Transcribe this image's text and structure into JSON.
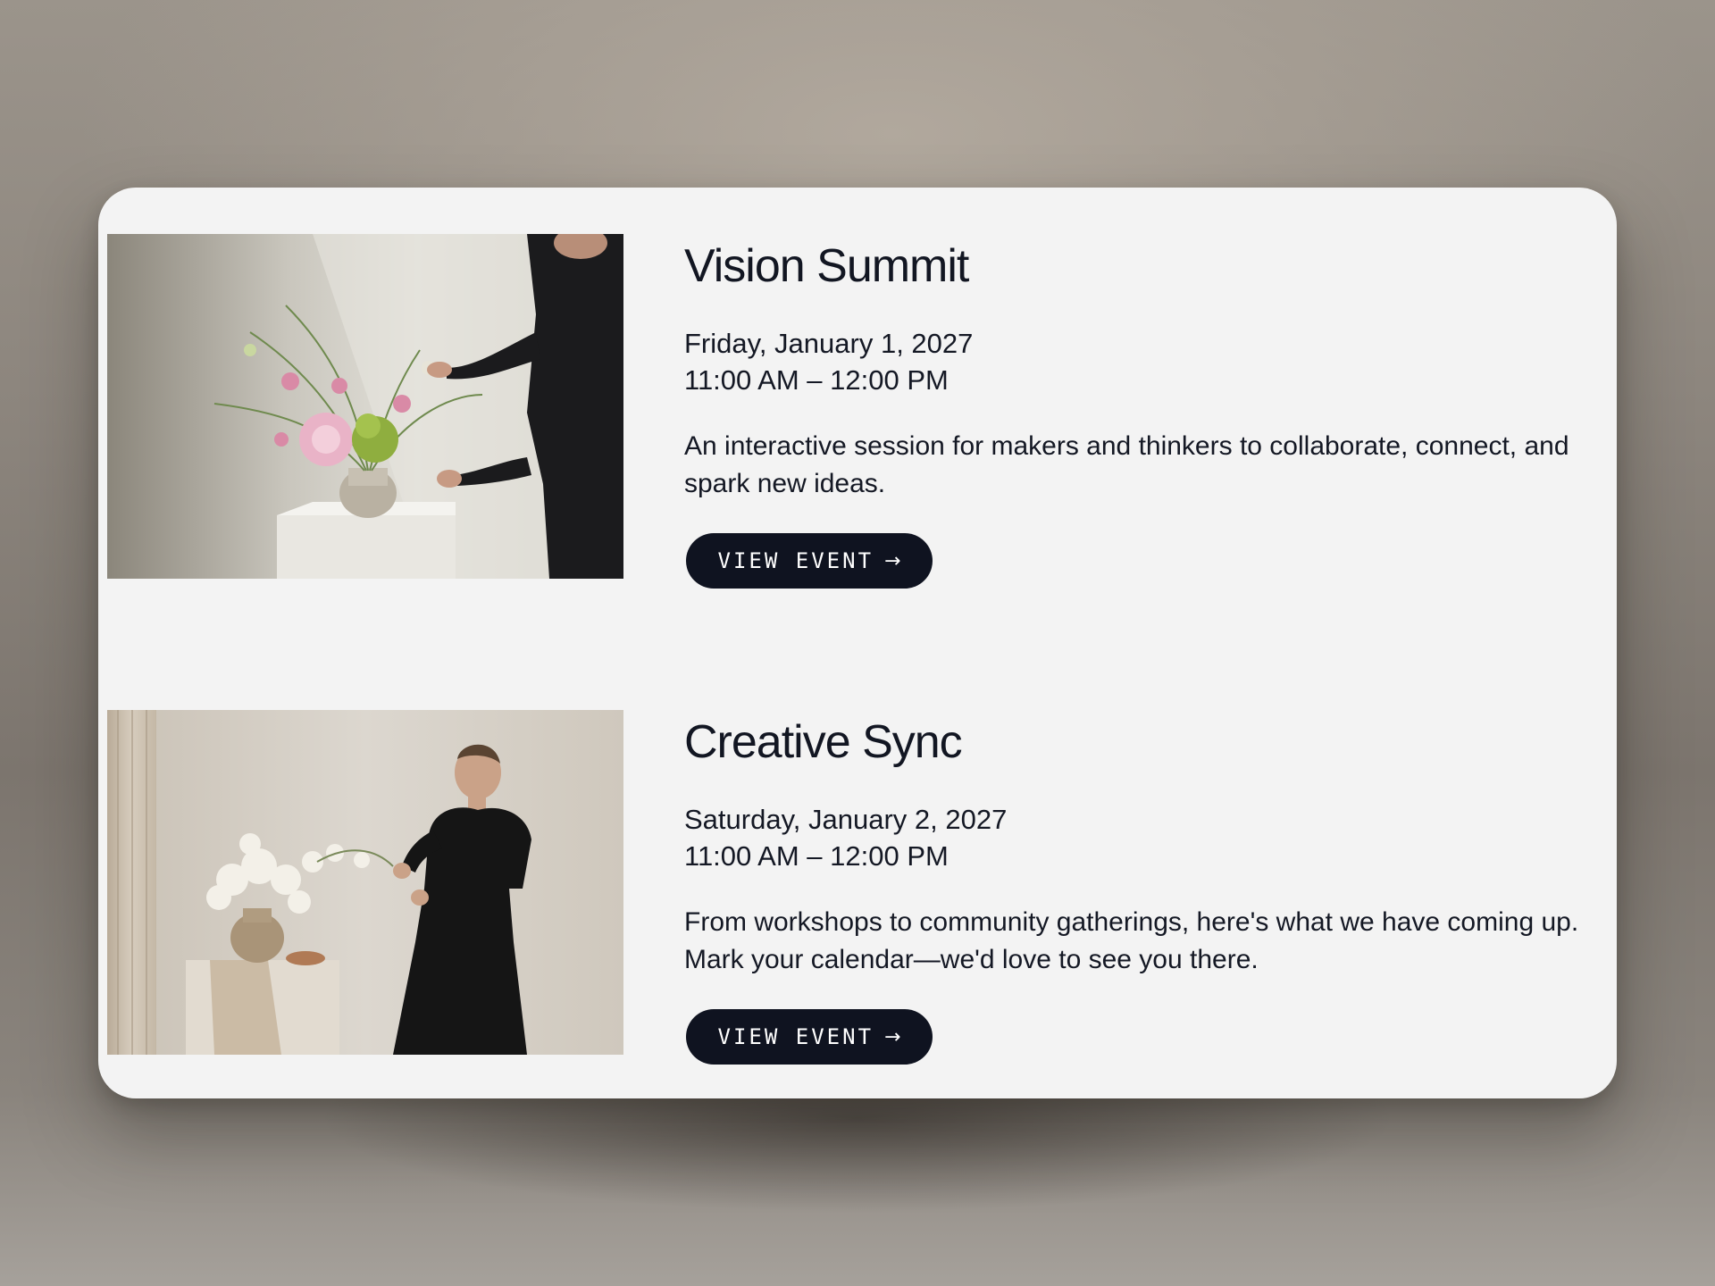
{
  "events": [
    {
      "title": "Vision Summit",
      "date": "Friday, January 1, 2027",
      "time": "11:00 AM – 12:00 PM",
      "description": "An interactive session for makers and thinkers to collaborate, connect, and spark new ideas.",
      "button_label": "VIEW EVENT",
      "button_icon": "arrow-right-icon",
      "arrow_glyph": "→",
      "image_alt": "Person arranging pink peonies and green flowers in a ceramic vase on a white pedestal"
    },
    {
      "title": "Creative Sync",
      "date": "Saturday, January 2, 2027",
      "time": "11:00 AM – 12:00 PM",
      "description": "From workshops to community gatherings, here's what we have coming up. Mark your calendar—we'd love to see you there.",
      "button_label": "VIEW EVENT",
      "button_icon": "arrow-right-icon",
      "arrow_glyph": "→",
      "image_alt": "Woman in a black dress arranging white orchids in a woven vase beside a draped pedestal"
    }
  ],
  "colors": {
    "panel_background": "#f3f3f3",
    "text_primary": "#121622",
    "button_background": "#0f1320",
    "button_text": "#ffffff"
  }
}
